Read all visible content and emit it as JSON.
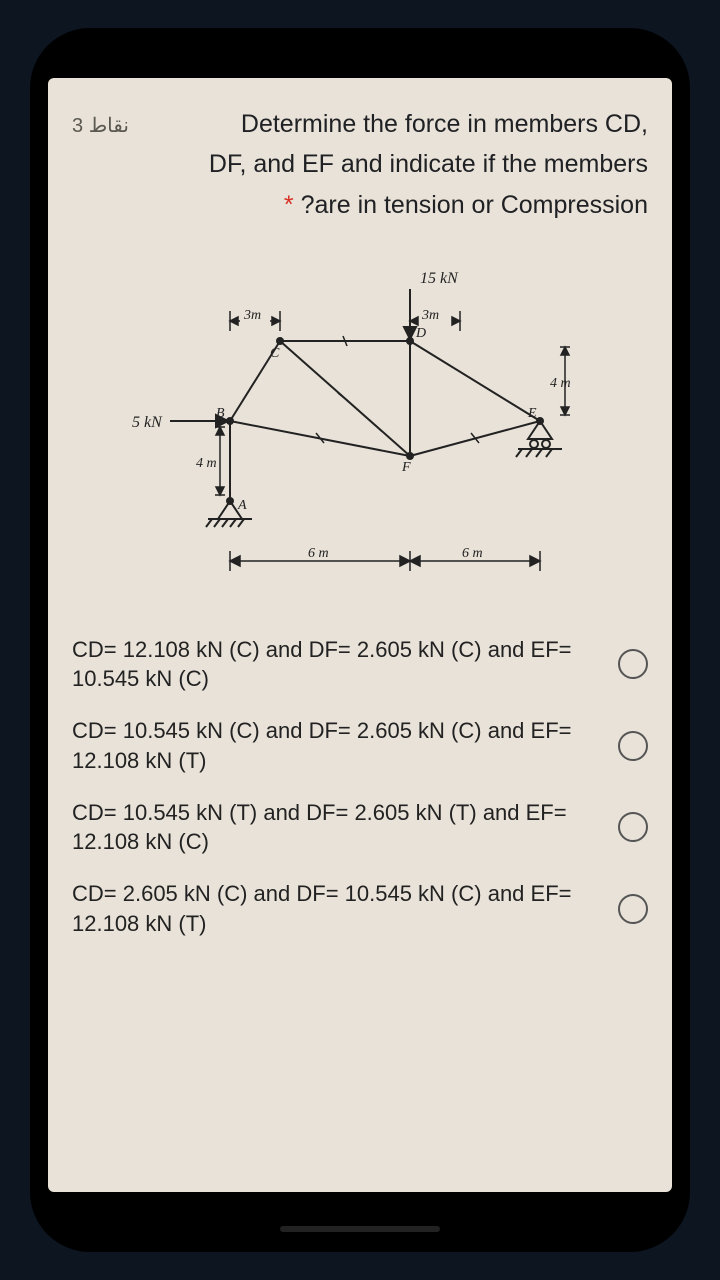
{
  "question": {
    "points_label": "3 نقاط",
    "line1": "Determine the force in members CD,",
    "line2": "DF, and EF and indicate if the members",
    "line3_prefix": "?are in tension or Compression",
    "asterisk": "*"
  },
  "figure": {
    "load_top": "15 kN",
    "load_left": "5 kN",
    "dim_3m_left": "3m",
    "dim_3m_right": "3m",
    "dim_4m_left": "4 m",
    "dim_4m_right": "4 m",
    "dim_6m_left": "6 m",
    "dim_6m_right": "6 m",
    "node_A": "A",
    "node_B": "B",
    "node_C": "C",
    "node_D": "D",
    "node_E": "E",
    "node_F": "F"
  },
  "options": [
    {
      "text": "CD= 12.108 kN (C) and DF= 2.605 kN (C) and EF= 10.545 kN (C)"
    },
    {
      "text": "CD= 10.545 kN (C) and DF= 2.605 kN (C) and EF= 12.108 kN (T)"
    },
    {
      "text": "CD= 10.545 kN (T) and DF= 2.605 kN (T) and EF= 12.108 kN (C)"
    },
    {
      "text": "CD= 2.605 kN (C) and DF= 10.545 kN (C) and EF= 12.108 kN (T)"
    }
  ]
}
